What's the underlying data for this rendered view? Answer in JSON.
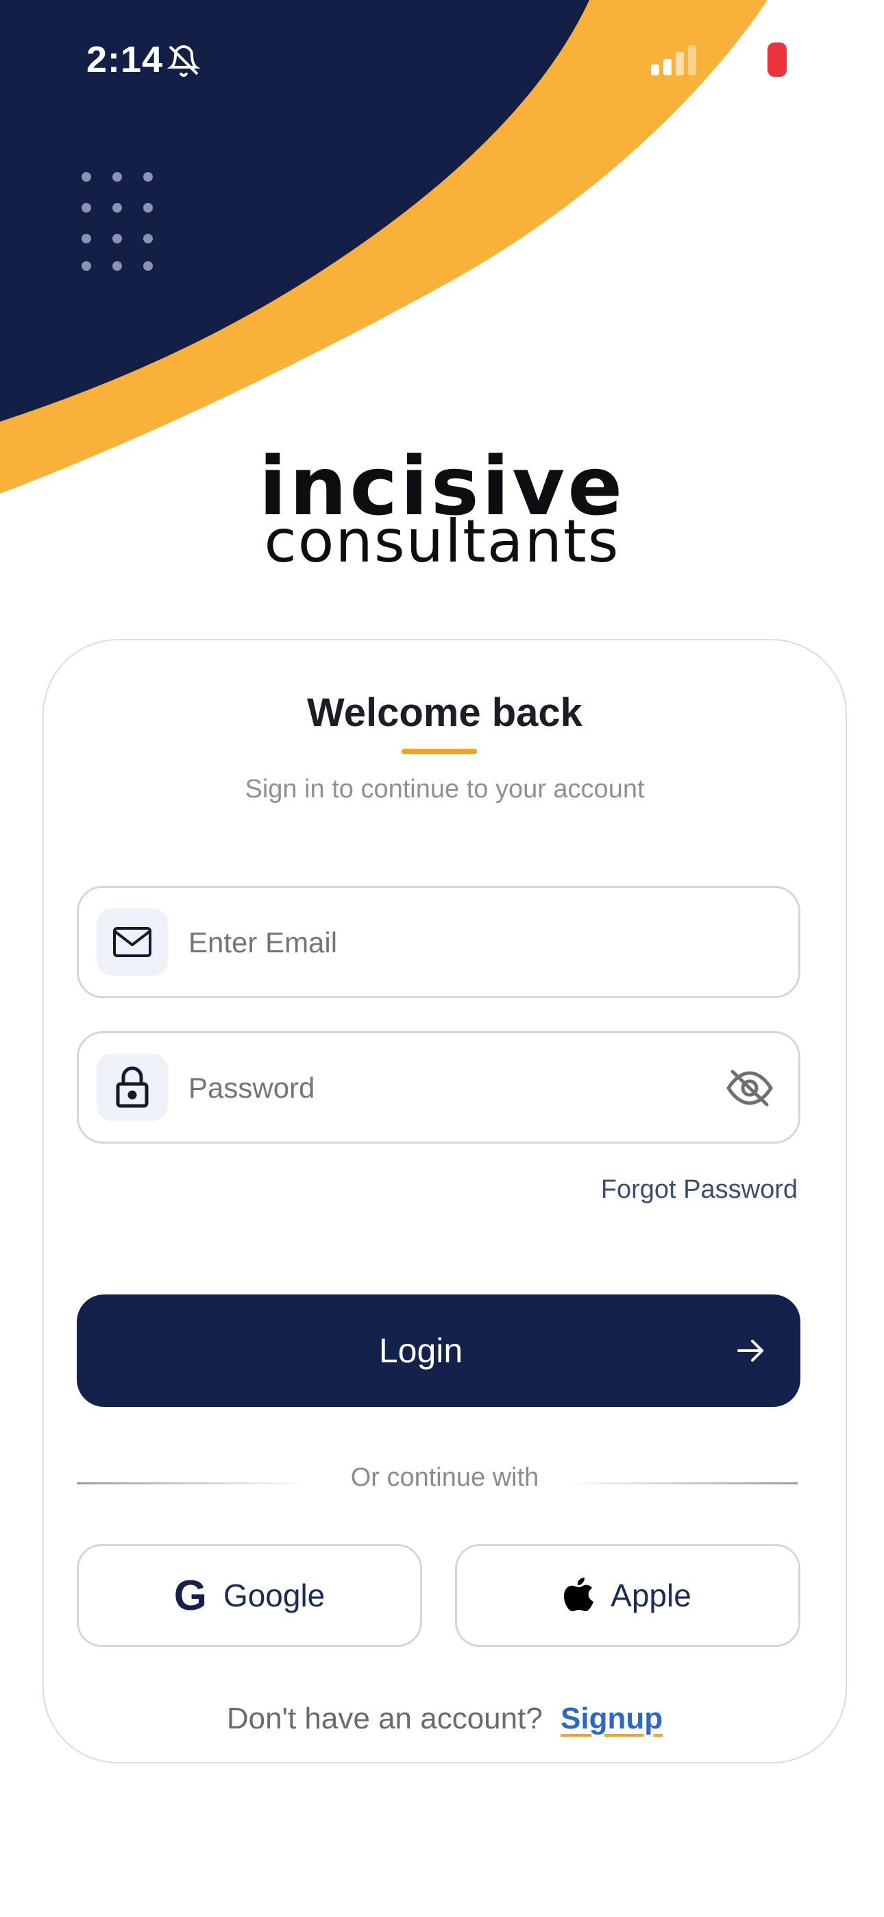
{
  "status_bar": {
    "time": "2:14",
    "icons": [
      "bell-off-icon",
      "signal-icon",
      "battery-icon"
    ]
  },
  "brand": {
    "line1": "incisive",
    "line2": "consultants"
  },
  "colors": {
    "navy": "#14214b",
    "accent": "#f4a31f",
    "link": "#2a67c9"
  },
  "login_form": {
    "title": "Welcome back",
    "subtitle": "Sign in to continue to your account",
    "email_placeholder": "Enter Email",
    "password_placeholder": "Password",
    "forgot_password": "Forgot Password",
    "login_button": "Login",
    "divider_text": "Or continue with",
    "google_label": "Google",
    "apple_label": "Apple",
    "signup_prompt": "Don't have an account?",
    "signup_link": "Signup"
  }
}
